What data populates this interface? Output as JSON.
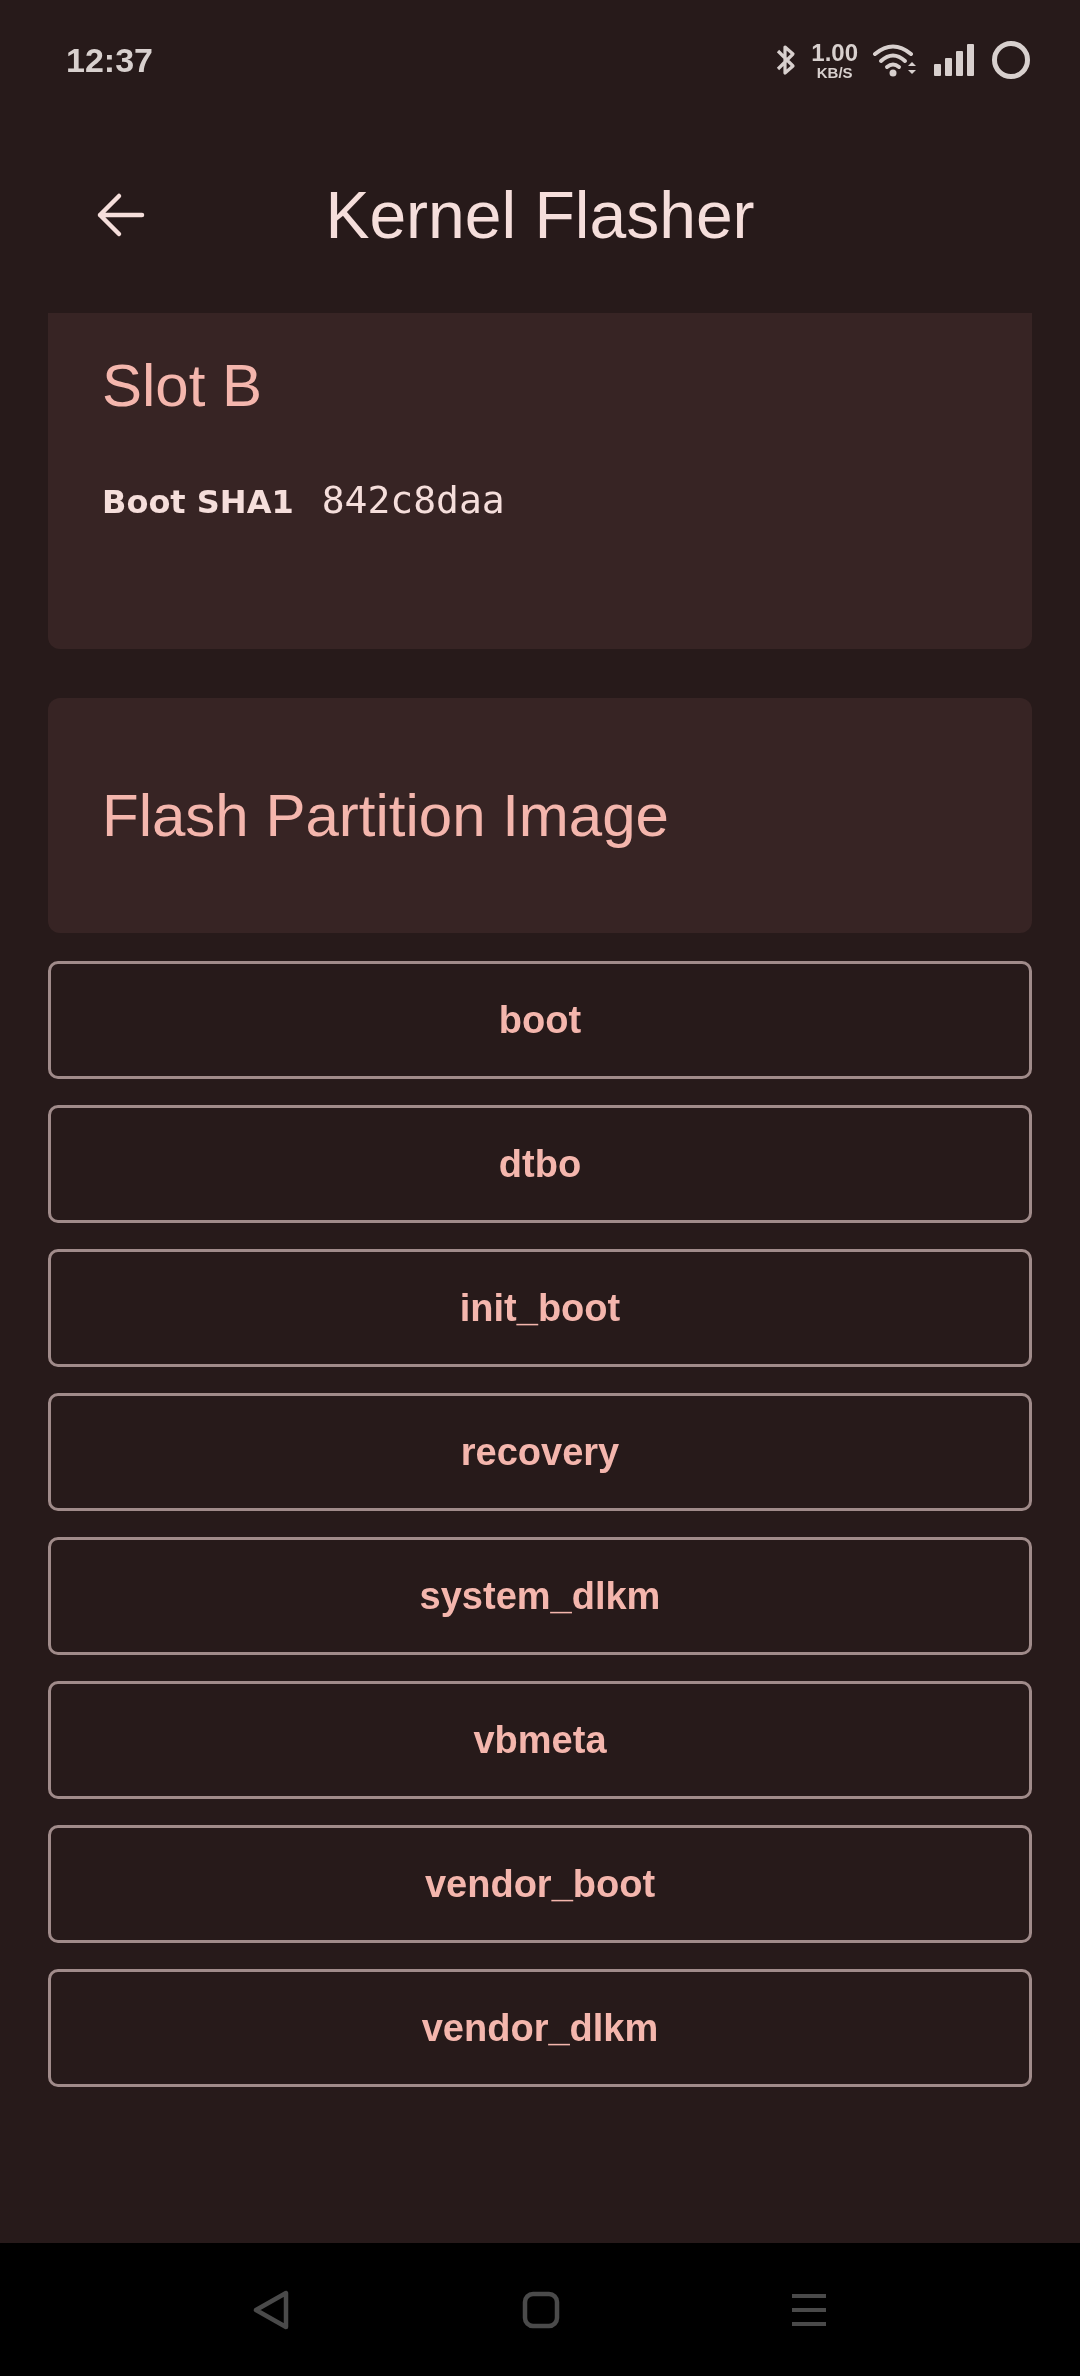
{
  "status_bar": {
    "time": "12:37",
    "net_speed": "1.00",
    "net_unit": "KB/S"
  },
  "app_bar": {
    "title": "Kernel Flasher"
  },
  "slot_card": {
    "title": "Slot B",
    "label": "Boot SHA1",
    "value": "842c8daa"
  },
  "flash_card": {
    "title": "Flash Partition Image"
  },
  "partitions": [
    "boot",
    "dtbo",
    "init_boot",
    "recovery",
    "system_dlkm",
    "vbmeta",
    "vendor_boot",
    "vendor_dlkm"
  ]
}
